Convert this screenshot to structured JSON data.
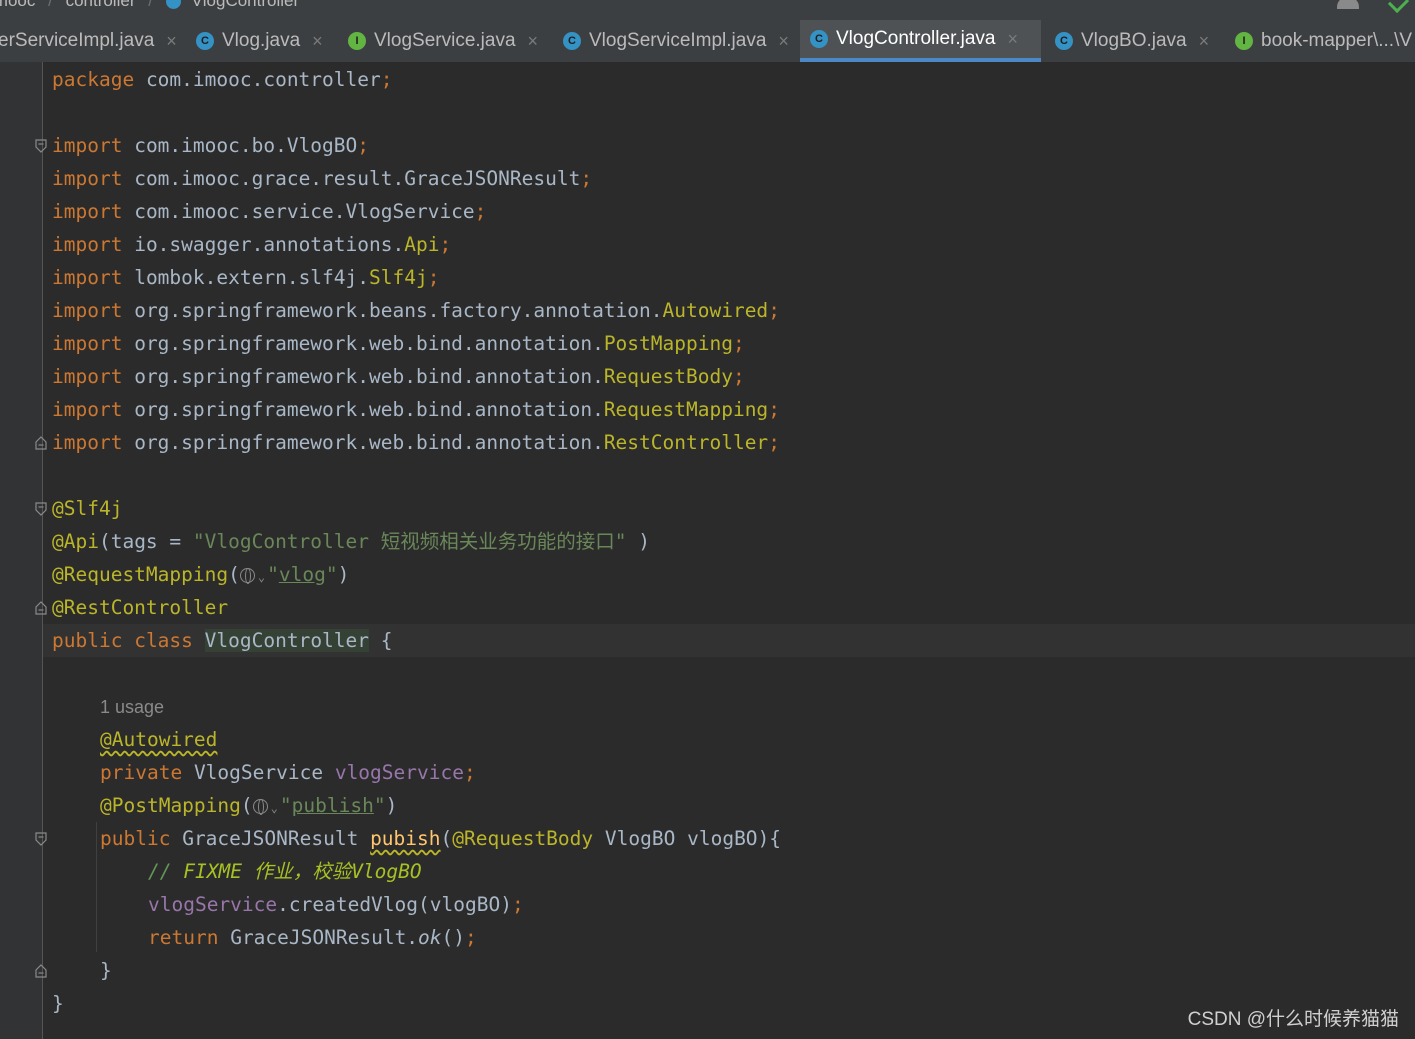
{
  "breadcrumb": {
    "items": [
      "imooc",
      "controller",
      "VlogController"
    ]
  },
  "tabs": [
    {
      "label": "erServiceImpl.java",
      "icon": "class-icon",
      "active": false
    },
    {
      "label": "Vlog.java",
      "icon": "class-icon",
      "active": false
    },
    {
      "label": "VlogService.java",
      "icon": "interface-icon",
      "active": false
    },
    {
      "label": "VlogServiceImpl.java",
      "icon": "class-icon",
      "active": false
    },
    {
      "label": "VlogController.java",
      "icon": "class-icon",
      "active": true
    },
    {
      "label": "VlogBO.java",
      "icon": "class-icon",
      "active": false
    },
    {
      "label": "book-mapper\\...\\V",
      "icon": "interface-icon",
      "active": false
    }
  ],
  "icon_glyphs": {
    "class": "C",
    "interface": "I",
    "close": "×"
  },
  "code": {
    "package_kw": "package",
    "package_name": "com.imooc.controller",
    "semi": ";",
    "import_kw": "import",
    "imports": [
      {
        "prefix": "com.imooc.bo.VlogBO",
        "cls": ""
      },
      {
        "prefix": "com.imooc.grace.result.GraceJSONResult",
        "cls": ""
      },
      {
        "prefix": "com.imooc.service.VlogService",
        "cls": ""
      },
      {
        "prefix": "io.swagger.annotations.",
        "cls": "Api"
      },
      {
        "prefix": "lombok.extern.slf4j.",
        "cls": "Slf4j"
      },
      {
        "prefix": "org.springframework.beans.factory.annotation.",
        "cls": "Autowired"
      },
      {
        "prefix": "org.springframework.web.bind.annotation.",
        "cls": "PostMapping"
      },
      {
        "prefix": "org.springframework.web.bind.annotation.",
        "cls": "RequestBody"
      },
      {
        "prefix": "org.springframework.web.bind.annotation.",
        "cls": "RequestMapping"
      },
      {
        "prefix": "org.springframework.web.bind.annotation.",
        "cls": "RestController"
      }
    ],
    "ann_slf4j": "@Slf4j",
    "ann_api": "@Api",
    "api_open": "(tags = ",
    "api_tags": "\"VlogController 短视频相关业务功能的接口\"",
    "api_close": " )",
    "ann_request_mapping": "@RequestMapping",
    "paren_open": "(",
    "quote": "\"",
    "request_mapping_value": "vlog",
    "paren_close": ")",
    "ann_rest_controller": "@RestController",
    "public_kw": "public",
    "class_kw": "class",
    "class_name": "VlogController",
    "brace_open": "{",
    "usage_hint": "1 usage",
    "ann_autowired": "@Autowired",
    "private_kw": "private",
    "field_type": "VlogService",
    "field_name": "vlogService",
    "ann_post_mapping": "@PostMapping",
    "post_mapping_value": "publish",
    "return_type": "GraceJSONResult",
    "method_name": "pubish",
    "param_ann": "@RequestBody",
    "param_type": "VlogBO",
    "param_name": "vlogBO",
    "method_sig_close": "){",
    "comment_slashes": "//",
    "comment_todo": "FIXME",
    "comment_text": "作业，校验VlogBO",
    "call_target": "vlogService",
    "call_rest": ".createdVlog(vlogBO)",
    "return_kw": "return",
    "return_class": "GraceJSONResult.",
    "return_method": "ok",
    "return_parens": "()",
    "brace_close": "}"
  },
  "watermark": "CSDN @什么时候养猫猫"
}
